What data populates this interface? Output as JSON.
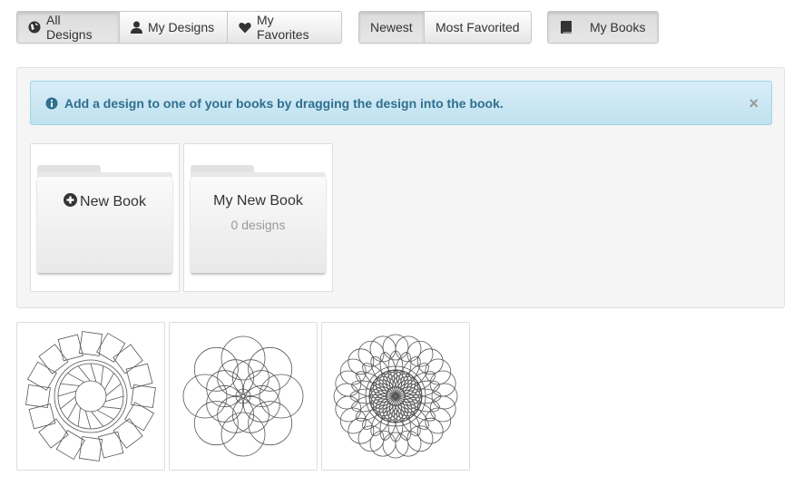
{
  "filters": [
    {
      "label": "All Designs",
      "icon": "globe-icon",
      "active": true
    },
    {
      "label": "My Designs",
      "icon": "user-icon",
      "active": false
    },
    {
      "label": "My Favorites",
      "icon": "heart-icon",
      "active": false
    }
  ],
  "sort": [
    {
      "label": "Newest",
      "active": true
    },
    {
      "label": "Most Favorited",
      "active": false
    }
  ],
  "books_button": {
    "label": "My Books",
    "icon": "book-icon"
  },
  "alert": {
    "text": "Add a design to one of your books by dragging the design into the book.",
    "close": "×",
    "icon": "info-circle-icon"
  },
  "books": [
    {
      "title": "New Book",
      "icon": "plus-circle-icon"
    },
    {
      "title": "My New Book",
      "count": "0 designs"
    }
  ],
  "designs": [
    {
      "pattern": "square-petal-mandala"
    },
    {
      "pattern": "circle-rosette"
    },
    {
      "pattern": "spirograph-lace"
    }
  ],
  "colors": {
    "alert_text": "#2f6f8f",
    "alert_bg": "#d9edf7",
    "line_art": "#555555"
  }
}
